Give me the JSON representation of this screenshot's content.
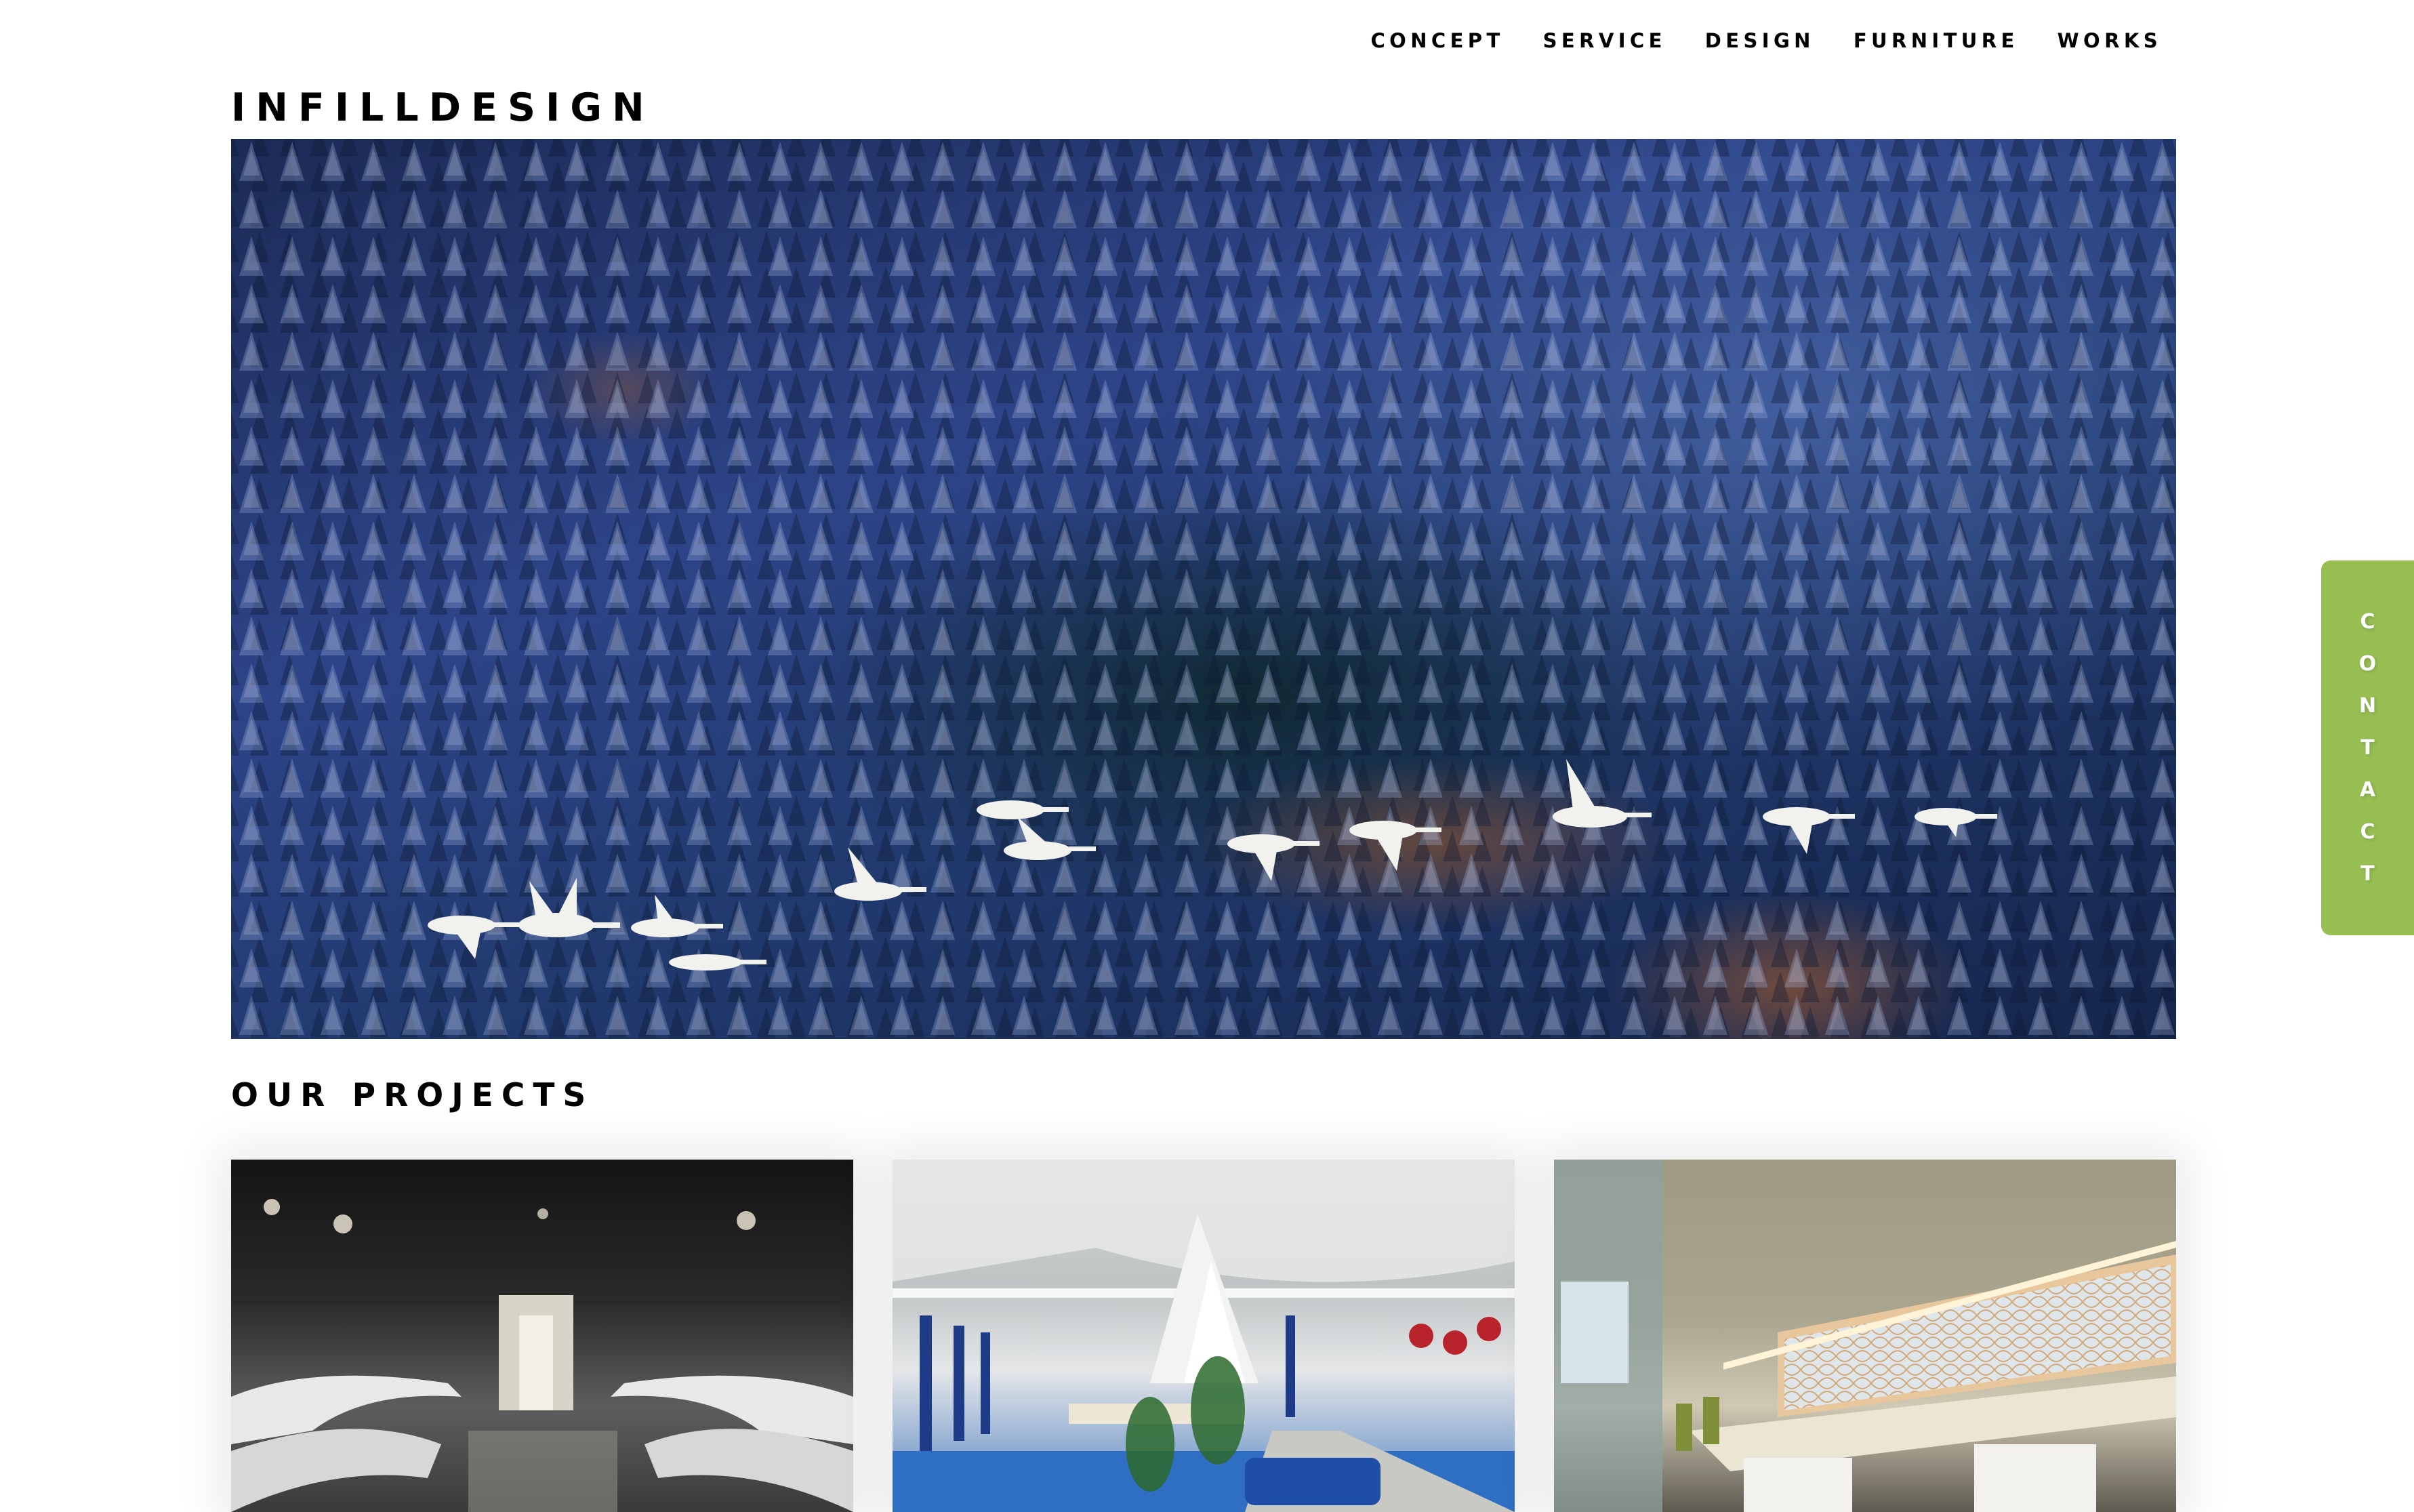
{
  "nav": {
    "items": [
      {
        "label": "CONCEPT"
      },
      {
        "label": "SERVICE"
      },
      {
        "label": "DESIGN"
      },
      {
        "label": "FURNITURE"
      },
      {
        "label": "WORKS"
      }
    ]
  },
  "brand": {
    "logo_text": "INFILLDESIGN"
  },
  "hero": {
    "image_alt": "Aerial view of a snow-dusted cedar forest with a flock of white swans flying across"
  },
  "projects": {
    "title": "OUR PROJECTS",
    "items": [
      {
        "image_alt": "Dark meeting room with curved white tables and a lit corridor"
      },
      {
        "image_alt": "Open office with exposed white ducts, white tent structure, plants and blue carpet"
      },
      {
        "image_alt": "Office desk row with wooden lattice light panel and green chairs"
      }
    ]
  },
  "contact": {
    "label": "CONTACT",
    "letters": [
      "C",
      "O",
      "N",
      "T",
      "A",
      "C",
      "T"
    ],
    "color": "#97bf52"
  }
}
